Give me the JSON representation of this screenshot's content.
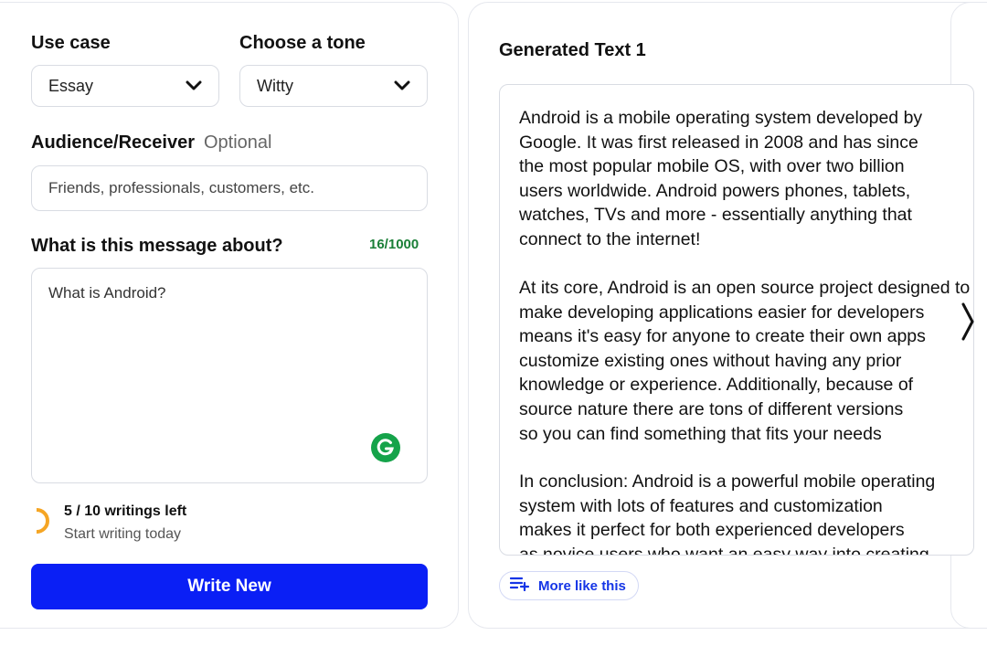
{
  "form": {
    "use_case_label": "Use case",
    "use_case_value": "Essay",
    "tone_label": "Choose a tone",
    "tone_value": "Witty",
    "audience_label": "Audience/Receiver",
    "audience_optional": "Optional",
    "audience_placeholder": "Friends, professionals, customers, etc.",
    "message_label": "What is this message about?",
    "message_counter": "16/1000",
    "message_value": "What is Android?"
  },
  "quota": {
    "count_text": "5 / 10 writings left",
    "subtext": "Start writing today",
    "progress_fraction": 0.5,
    "accent_color": "#f5a524"
  },
  "write_button": {
    "label": "Write New",
    "color": "#0a1ff5"
  },
  "generated": {
    "title": "Generated Text 1",
    "paragraphs": [
      [
        "Android is a mobile operating system developed by",
        "Google. It was first released in 2008 and has since",
        "the most popular mobile OS, with over two billion",
        "users worldwide. Android powers phones, tablets,",
        "watches, TVs and more - essentially anything that",
        "connect to the internet!"
      ],
      [
        "At its core, Android is an open source project designed to",
        "make developing applications easier for developers",
        "means it's easy for anyone to create their own apps",
        "customize existing ones without having any prior",
        "knowledge or experience. Additionally, because of",
        "source nature there are tons of different versions",
        "so you can find something that fits your needs"
      ],
      [
        "In conclusion: Android is a powerful mobile operating",
        "system with lots of features and customization",
        "makes it perfect for both experienced developers",
        "as novice users who want an easy way into creating"
      ]
    ],
    "more_label": "More like this"
  },
  "icons": {
    "chevron": "chevron-down-icon",
    "grammarly": "grammarly-icon",
    "more": "playlist-add-icon",
    "next": "chevron-right-icon"
  }
}
